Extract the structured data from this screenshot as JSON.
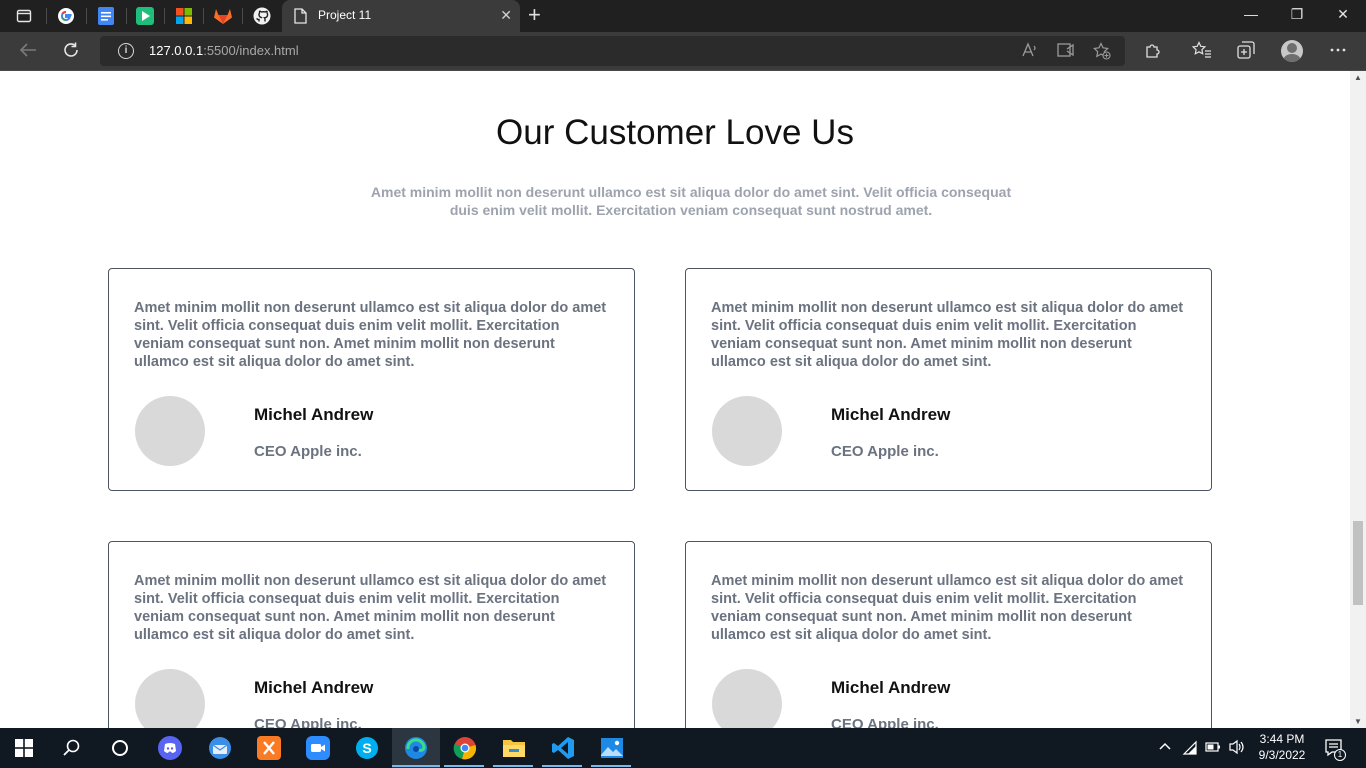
{
  "browser": {
    "tab_title": "Project 11",
    "close_tab": "✕",
    "new_tab": "+",
    "url_host": "127.0.0.1",
    "url_path": ":5500/index.html",
    "window": {
      "minimize": "—",
      "restore": "❐",
      "close": "✕"
    }
  },
  "page": {
    "heading": "Our Customer Love Us",
    "subtitle": "Amet minim mollit non deserunt ullamco est sit aliqua dolor do amet sint. Velit officia consequat duis enim velit mollit. Exercitation veniam consequat sunt nostrud amet.",
    "cards": [
      {
        "quote": "Amet minim mollit non deserunt ullamco est sit aliqua dolor do amet sint. Velit officia consequat duis enim velit mollit. Exercitation veniam consequat sunt non. Amet minim mollit non deserunt ullamco est sit aliqua dolor do amet sint.",
        "name": "Michel Andrew",
        "role": "CEO Apple inc."
      },
      {
        "quote": "Amet minim mollit non deserunt ullamco est sit aliqua dolor do amet sint. Velit officia consequat duis enim velit mollit. Exercitation veniam consequat sunt non. Amet minim mollit non deserunt ullamco est sit aliqua dolor do amet sint.",
        "name": "Michel Andrew",
        "role": "CEO Apple inc."
      },
      {
        "quote": "Amet minim mollit non deserunt ullamco est sit aliqua dolor do amet sint. Velit officia consequat duis enim velit mollit. Exercitation veniam consequat sunt non. Amet minim mollit non deserunt ullamco est sit aliqua dolor do amet sint.",
        "name": "Michel Andrew",
        "role": "CEO Apple inc."
      },
      {
        "quote": "Amet minim mollit non deserunt ullamco est sit aliqua dolor do amet sint. Velit officia consequat duis enim velit mollit. Exercitation veniam consequat sunt non. Amet minim mollit non deserunt ullamco est sit aliqua dolor do amet sint.",
        "name": "Michel Andrew",
        "role": "CEO Apple inc."
      }
    ]
  },
  "taskbar": {
    "time": "3:44 PM",
    "date": "9/3/2022",
    "notification_count": "1"
  },
  "colors": {
    "titlebar_bg": "#202020",
    "toolbar_bg": "#3b3b3b",
    "card_border": "#4b5563",
    "subtitle_text": "#9da3ae",
    "avatar_placeholder": "#d9d9d9",
    "taskbar_bg": "#101822"
  },
  "icons": {
    "tab_bar": [
      "tab-actions-icon",
      "google-icon",
      "docs-icon",
      "play-icon",
      "microsoft-icon",
      "gitlab-icon",
      "github-icon"
    ],
    "toolbar": [
      "back-icon",
      "refresh-icon",
      "read-aloud-icon",
      "immersive-reader-icon",
      "add-favorite-icon",
      "extensions-icon",
      "favorites-icon",
      "collections-icon",
      "profile-icon",
      "more-icon"
    ],
    "taskbar": [
      "windows-start-icon",
      "search-icon",
      "cortana-icon",
      "discord-icon",
      "thunderbird-icon",
      "xampp-icon",
      "zoom-icon",
      "skype-icon",
      "edge-icon",
      "chrome-icon",
      "file-explorer-icon",
      "vscode-icon",
      "photos-icon"
    ]
  }
}
